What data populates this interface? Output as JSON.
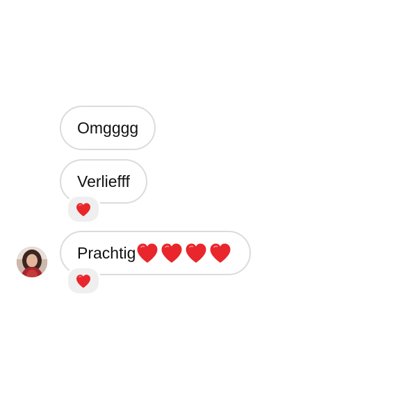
{
  "thread": {
    "messages": [
      {
        "text": "Omgggg",
        "hearts": 0,
        "reaction": null
      },
      {
        "text": "Verliefff",
        "hearts": 0,
        "reaction": "red-heart-icon"
      },
      {
        "text": "Prachtig",
        "hearts": 4,
        "reaction": "red-heart-icon"
      }
    ],
    "sender_avatar": "avatar-photo",
    "colors": {
      "bubble_border": "#dbdbdb",
      "reaction_bg": "#efefef",
      "heart_red": "#e8262b"
    }
  }
}
